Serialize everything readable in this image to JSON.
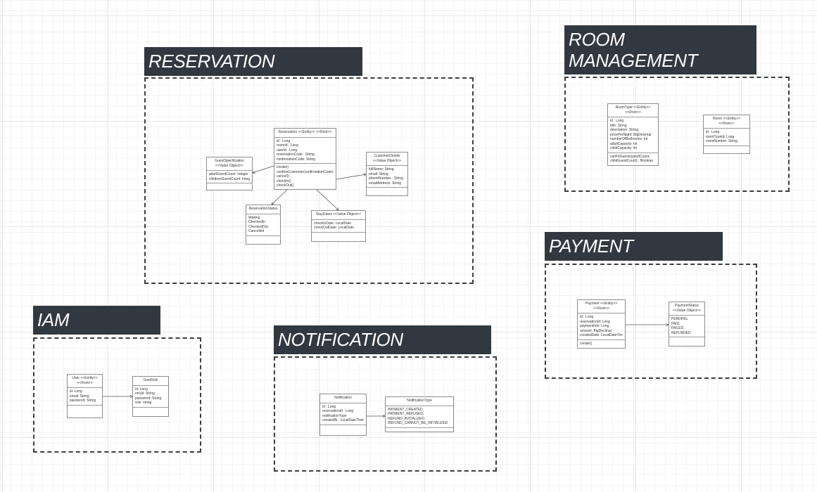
{
  "contexts": {
    "reservation": "RESERVATION CONTEXT",
    "room_management": "ROOM MANAGEMENT\nCONTEXT",
    "payment": "PAYMENT CONTEXT",
    "iam": "IAM CONTEXT",
    "notification": "NOTIFICATION CONTEXT"
  },
  "classes": {
    "reservation": {
      "header": "Reservation <<Entity>> <<Root>>",
      "attributes": [
        "id : Long",
        "roomId : Long",
        "userId : Long",
        "reservationCode : String",
        "confirmationCode: String"
      ],
      "operations": [
        "create()",
        "confirmCustomer(confirmationCode)",
        "cancel()",
        "checkIn()",
        "checkOut()"
      ]
    },
    "guest_specification": {
      "header": "GuestSpecification\n<<Value Object>>",
      "attributes": [
        "adultGuestCount: Integer",
        "childrenGuestCount: Integer"
      ],
      "operations": []
    },
    "customer_details": {
      "header": "CustomerDetails\n<<Value Object>>",
      "attributes": [
        "fullName: String",
        "email: String",
        "phoneNumber : String",
        "emailAddress: String"
      ],
      "operations": []
    },
    "reservation_status": {
      "header": "ReservationStatus",
      "attributes": [
        "Waiting",
        "CheckedIn",
        "CheckedOut",
        "Cancelled"
      ],
      "operations": []
    },
    "stay_dates": {
      "header": "StayDates <<Value Object>>",
      "attributes": [
        "checkInDate: LocalDate",
        "checkOutDate: LocalDate"
      ],
      "operations": []
    },
    "room_type": {
      "header": "RoomType <<Entity>>\n<<Root>>",
      "attributes": [
        "id : Long",
        "title: String",
        "description: String",
        "pricePerNight: BigDecimal",
        "numberOfBedrooms: Int",
        "adultCapacity: Int",
        "childCapacity: Int"
      ],
      "operations": [
        "canFitGuests(adultCount,",
        "childGuestCount) : Boolean"
      ]
    },
    "room": {
      "header": "Room <<Entity>>\n<<Root>>",
      "attributes": [
        "id : Long",
        "roomTypeId: Long",
        "roomNumber: String"
      ],
      "operations": []
    },
    "payment": {
      "header": "Payment <<Entity>>\n<<Root>>",
      "attributes": [
        "id : Long",
        "reservationId: Long",
        "paymentInfo: Long",
        "amount: BigDecimal",
        "createdDate: LocalDateTime"
      ],
      "operations": [
        "create()"
      ]
    },
    "payment_status": {
      "header": "PaymentStatus\n<<Value Object>>",
      "attributes": [
        "PENDING,",
        "PAID,",
        "FAILED,",
        "REFUNDED"
      ],
      "operations": []
    },
    "user": {
      "header": "User <<Entity>>\n<<Root>>",
      "attributes": [
        "id: Long",
        "email: String",
        "password: String"
      ],
      "operations": []
    },
    "user_role": {
      "header": "UserRole",
      "attributes": [
        "id: Long",
        "email: String",
        "password: String",
        "role: string"
      ],
      "operations": []
    },
    "notification": {
      "header": "Notification",
      "attributes": [
        "id : Long",
        "reservationId : Long",
        "notificationType",
        "createdAt : LocalDateTime"
      ],
      "operations": []
    },
    "notification_type": {
      "header": "NotificationType",
      "attributes": [
        "PAYMENT_CREATED,",
        "PAYMENT_REFUSED,",
        "REFUND_INITIALIZED,",
        "REFUND_CANNOT_BE_INITIALIZED"
      ],
      "operations": []
    }
  }
}
